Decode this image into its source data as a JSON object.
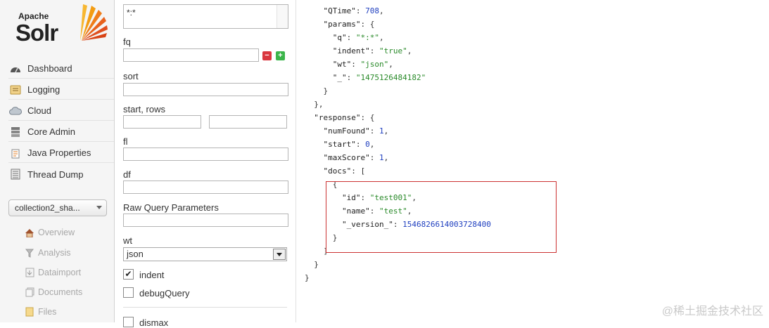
{
  "logo": {
    "top": "Apache",
    "main": "Solr"
  },
  "nav": [
    {
      "label": "Dashboard",
      "icon": "dashboard-icon"
    },
    {
      "label": "Logging",
      "icon": "logging-icon"
    },
    {
      "label": "Cloud",
      "icon": "cloud-icon"
    },
    {
      "label": "Core Admin",
      "icon": "core-admin-icon"
    },
    {
      "label": "Java Properties",
      "icon": "java-icon"
    },
    {
      "label": "Thread Dump",
      "icon": "thread-dump-icon"
    }
  ],
  "core_selector": {
    "value": "collection2_sha..."
  },
  "core_menu": [
    {
      "label": "Overview",
      "icon": "home-icon"
    },
    {
      "label": "Analysis",
      "icon": "filter-icon"
    },
    {
      "label": "Dataimport",
      "icon": "dataimport-icon"
    },
    {
      "label": "Documents",
      "icon": "documents-icon"
    },
    {
      "label": "Files",
      "icon": "files-icon"
    }
  ],
  "form": {
    "q_value": "*:*",
    "fq_label": "fq",
    "sort_label": "sort",
    "start_rows_label": "start, rows",
    "fl_label": "fl",
    "df_label": "df",
    "raw_label": "Raw Query Parameters",
    "wt_label": "wt",
    "wt_value": "json",
    "indent_label": "indent",
    "indent_checked": true,
    "debug_label": "debugQuery",
    "debug_checked": false,
    "dismax_label": "dismax",
    "remove_symbol": "−",
    "add_symbol": "+"
  },
  "response": {
    "QTime": "708",
    "q": "*:*",
    "indent": "true",
    "wt": "json",
    "_": "1475126484182",
    "numFound": "1",
    "start": "0",
    "maxScore": "1",
    "doc_id": "test001",
    "doc_name": "test",
    "doc_version": "1546826614003728400"
  },
  "watermark": "@稀土掘金技术社区",
  "colors": {
    "highlight_border": "#cc3333",
    "string": "#2a8a2a",
    "number": "#1f3fbf",
    "remove": "#d9363e",
    "add": "#3bb54a"
  }
}
